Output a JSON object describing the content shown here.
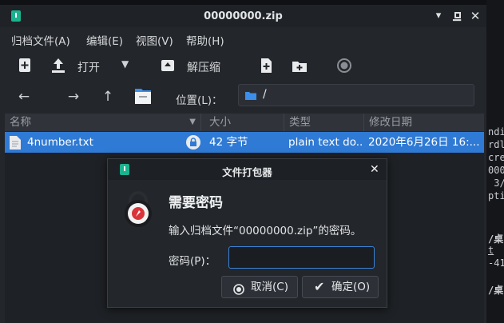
{
  "window": {
    "title": "00000000.zip"
  },
  "menu": [
    "归档文件(A)",
    "编辑(E)",
    "视图(V)",
    "帮助(H)"
  ],
  "toolbar": {
    "open_label": "打开",
    "extract_label": "解压缩"
  },
  "location": {
    "label": "位置(L)：",
    "path": "/"
  },
  "columns": [
    "名称",
    "大小",
    "类型",
    "修改日期"
  ],
  "files": [
    {
      "name": "4number.txt",
      "size": "42 字节",
      "type": "plain text do...",
      "modified": "2020年6月26日 16:..."
    }
  ],
  "dialog": {
    "title": "文件打包器",
    "heading": "需要密码",
    "message": "输入归档文件“00000000.zip”的密码。",
    "password_label": "密码(P)：",
    "password_value": "",
    "cancel_label": "取消(C)",
    "ok_label": "确定(O)"
  },
  "background_terminal": {
    "lines": [
      "ndi",
      "rdl",
      "cre",
      "000",
      " 3/",
      "pti",
      "/桌",
      "t",
      "-41",
      "/桌"
    ]
  },
  "colors": {
    "selection": "#2f7ad4",
    "accent_icon": "#1bb38f",
    "folder": "#3b8eea",
    "lock_icon": "#d9343a"
  }
}
